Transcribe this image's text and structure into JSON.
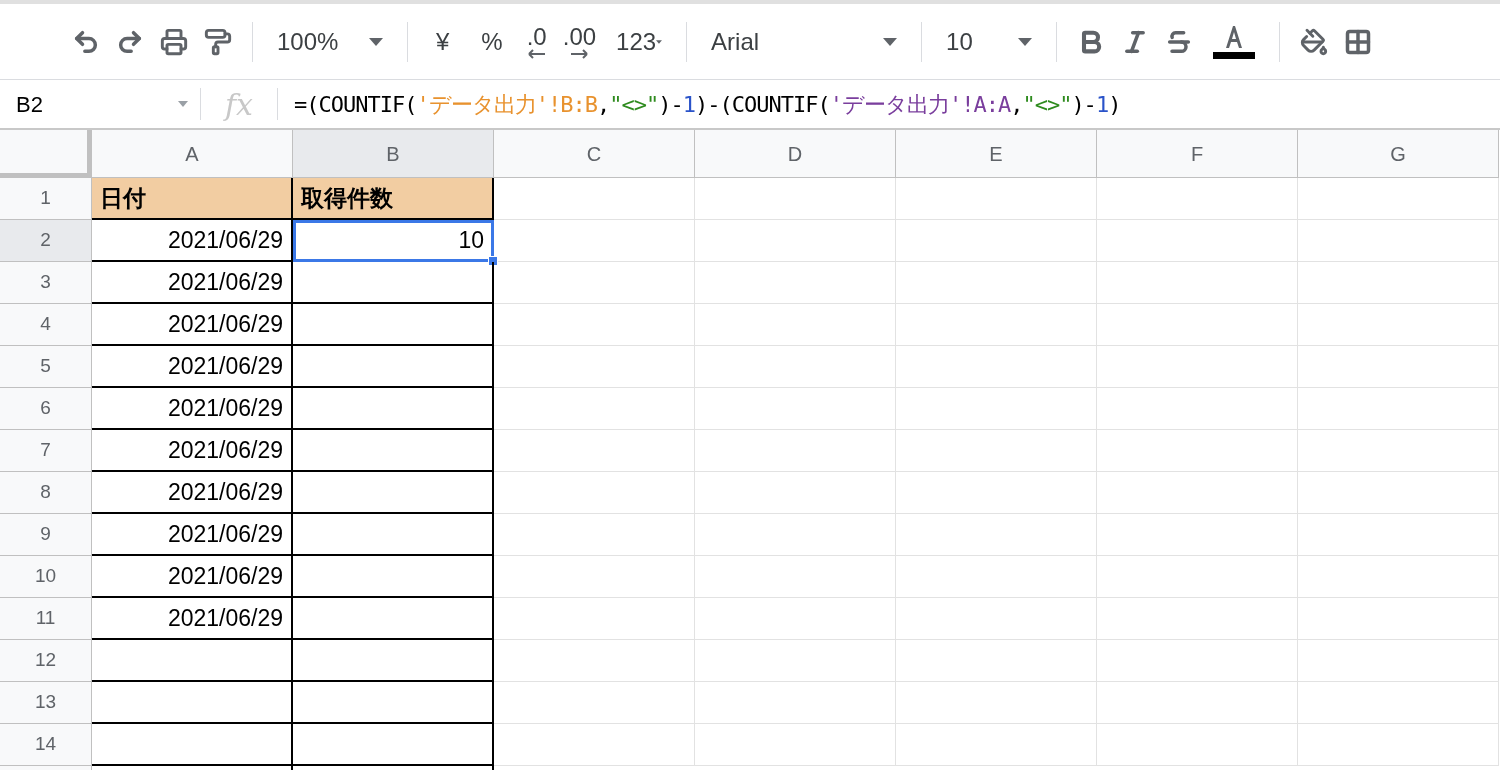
{
  "toolbar": [
    {
      "kind": "undo"
    },
    {
      "kind": "redo"
    },
    {
      "kind": "print"
    },
    {
      "kind": "paint-format"
    },
    {
      "kind": "sep"
    },
    {
      "kind": "zoom",
      "label": "100%"
    },
    {
      "kind": "sep"
    },
    {
      "kind": "text",
      "label": "¥"
    },
    {
      "kind": "text",
      "label": "%"
    },
    {
      "kind": "dec-less",
      "label": ".0"
    },
    {
      "kind": "dec-more",
      "label": ".00"
    },
    {
      "kind": "numfmt",
      "label": "123"
    },
    {
      "kind": "sep"
    },
    {
      "kind": "font",
      "label": "Arial"
    },
    {
      "kind": "sep"
    },
    {
      "kind": "size",
      "label": "10"
    },
    {
      "kind": "sep"
    },
    {
      "kind": "bold"
    },
    {
      "kind": "italic"
    },
    {
      "kind": "strike"
    },
    {
      "kind": "text-color",
      "color": "#000000"
    },
    {
      "kind": "sep"
    },
    {
      "kind": "fill"
    },
    {
      "kind": "borders"
    }
  ],
  "name_box": "B2",
  "function_label": "fx",
  "formula": [
    {
      "text": "=(COUNTIF(",
      "color": "#000000"
    },
    {
      "text": "'データ出力'!B:B",
      "color": "#e8922e"
    },
    {
      "text": ",",
      "color": "#000000"
    },
    {
      "text": "\"<>\"",
      "color": "#2e8b1e"
    },
    {
      "text": ")-",
      "color": "#000000"
    },
    {
      "text": "1",
      "color": "#2a53c9"
    },
    {
      "text": ")-(COUNTIF(",
      "color": "#000000"
    },
    {
      "text": "'データ出力'!A:A",
      "color": "#7a3e9d"
    },
    {
      "text": ",",
      "color": "#000000"
    },
    {
      "text": "\"<>\"",
      "color": "#2e8b1e"
    },
    {
      "text": ")-",
      "color": "#000000"
    },
    {
      "text": "1",
      "color": "#2a53c9"
    },
    {
      "text": ")",
      "color": "#000000"
    }
  ],
  "columns": [
    {
      "label": "A",
      "selected": false
    },
    {
      "label": "B",
      "selected": true
    },
    {
      "label": "C",
      "selected": false
    },
    {
      "label": "D",
      "selected": false
    },
    {
      "label": "E",
      "selected": false
    },
    {
      "label": "F",
      "selected": false
    },
    {
      "label": "G",
      "selected": false
    }
  ],
  "rows": [
    {
      "number": "1",
      "selected": false,
      "header": true,
      "cells": [
        {
          "text": "日付",
          "selected": false
        },
        {
          "text": "取得件数",
          "selected": false
        }
      ]
    },
    {
      "number": "2",
      "selected": true,
      "header": false,
      "cells": [
        {
          "text": "2021/06/29",
          "selected": false
        },
        {
          "text": "10",
          "selected": true
        }
      ]
    },
    {
      "number": "3",
      "selected": false,
      "header": false,
      "cells": [
        {
          "text": "2021/06/29",
          "selected": false
        },
        {
          "selected": false
        }
      ]
    },
    {
      "number": "4",
      "selected": false,
      "header": false,
      "cells": [
        {
          "text": "2021/06/29",
          "selected": false
        },
        {
          "selected": false
        }
      ]
    },
    {
      "number": "5",
      "selected": false,
      "header": false,
      "cells": [
        {
          "text": "2021/06/29",
          "selected": false
        },
        {
          "selected": false
        }
      ]
    },
    {
      "number": "6",
      "selected": false,
      "header": false,
      "cells": [
        {
          "text": "2021/06/29",
          "selected": false
        },
        {
          "selected": false
        }
      ]
    },
    {
      "number": "7",
      "selected": false,
      "header": false,
      "cells": [
        {
          "text": "2021/06/29",
          "selected": false
        },
        {
          "selected": false
        }
      ]
    },
    {
      "number": "8",
      "selected": false,
      "header": false,
      "cells": [
        {
          "text": "2021/06/29",
          "selected": false
        },
        {
          "selected": false
        }
      ]
    },
    {
      "number": "9",
      "selected": false,
      "header": false,
      "cells": [
        {
          "text": "2021/06/29",
          "selected": false
        },
        {
          "selected": false
        }
      ]
    },
    {
      "number": "10",
      "selected": false,
      "header": false,
      "cells": [
        {
          "text": "2021/06/29",
          "selected": false
        },
        {
          "selected": false
        }
      ]
    },
    {
      "number": "11",
      "selected": false,
      "header": false,
      "cells": [
        {
          "text": "2021/06/29",
          "selected": false
        },
        {
          "selected": false
        }
      ]
    },
    {
      "number": "12",
      "selected": false,
      "header": false,
      "cells": [
        {
          "selected": false
        },
        {
          "selected": false
        }
      ]
    },
    {
      "number": "13",
      "selected": false,
      "header": false,
      "cells": [
        {
          "selected": false
        },
        {
          "selected": false
        }
      ]
    },
    {
      "number": "14",
      "selected": false,
      "header": false,
      "cells": [
        {
          "selected": false
        },
        {
          "selected": false
        }
      ]
    }
  ]
}
